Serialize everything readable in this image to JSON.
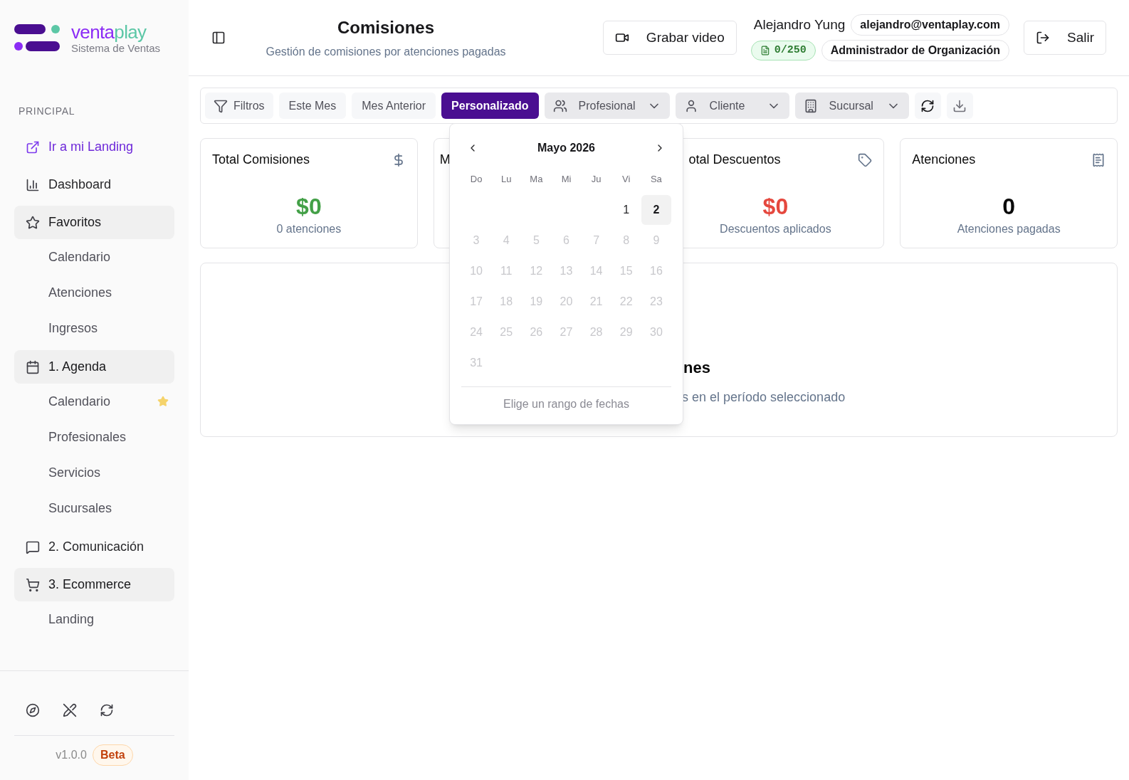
{
  "brand": {
    "parts": [
      "venta",
      "play"
    ],
    "subtitle": "Sistema de Ventas"
  },
  "header": {
    "title": "Comisiones",
    "subtitle": "Gestión de comisiones por atenciones pagadas",
    "record_button": "Grabar video",
    "user_name": "Alejandro Yung",
    "email": "alejandro@ventaplay.com",
    "quota": "0/250",
    "role": "Administrador de Organización",
    "logout_button": "Salir"
  },
  "sidebar": {
    "section": "PRINCIPAL",
    "items": [
      {
        "kind": "link",
        "label": "Ir a mi Landing"
      },
      {
        "kind": "item",
        "label": "Dashboard"
      },
      {
        "kind": "group",
        "label": "Favoritos",
        "expanded": true,
        "children": [
          {
            "label": "Calendario",
            "favorite": false
          },
          {
            "label": "Atenciones",
            "favorite": false
          },
          {
            "label": "Ingresos",
            "favorite": false
          }
        ]
      },
      {
        "kind": "group",
        "label": "1. Agenda",
        "expanded": true,
        "children": [
          {
            "label": "Calendario",
            "favorite": true
          },
          {
            "label": "Profesionales",
            "favorite": false
          },
          {
            "label": "Servicios",
            "favorite": false
          },
          {
            "label": "Sucursales",
            "favorite": false
          }
        ]
      },
      {
        "kind": "group",
        "label": "2. Comunicación",
        "expanded": false
      },
      {
        "kind": "group",
        "label": "3. Ecommerce",
        "expanded": true,
        "children": [
          {
            "label": "Landing",
            "favorite": false
          }
        ]
      }
    ],
    "version": "v1.0.0",
    "badge": "Beta"
  },
  "toolbar": {
    "filter_button": "Filtros",
    "periods": [
      {
        "label": "Este Mes",
        "selected": false
      },
      {
        "label": "Mes Anterior",
        "selected": false
      },
      {
        "label": "Personalizado",
        "selected": true
      }
    ],
    "dropdowns": [
      {
        "label": "Profesional"
      },
      {
        "label": "Cliente"
      },
      {
        "label": "Sucursal"
      }
    ]
  },
  "cards": [
    {
      "title": "Total Comisiones",
      "value": "$0",
      "caption": "0 atenciones",
      "color": "#43a047"
    },
    {
      "title": "M"
    },
    {
      "title": "otal Descuentos",
      "value": "$0",
      "caption": "Descuentos aplicados",
      "color": "#e5483e"
    },
    {
      "title": "Atenciones",
      "value": "0",
      "caption": "Atenciones pagadas",
      "color": "#0a0a0a"
    }
  ],
  "empty_state": {
    "title": "nes",
    "message": "s en el período seleccionado"
  },
  "calendar": {
    "month": "Mayo 2026",
    "weekdays": [
      "Do",
      "Lu",
      "Ma",
      "Mi",
      "Ju",
      "Vi",
      "Sa"
    ],
    "days": [
      {
        "kind": "blank"
      },
      {
        "kind": "blank"
      },
      {
        "kind": "blank"
      },
      {
        "kind": "blank"
      },
      {
        "kind": "blank"
      },
      {
        "kind": "day",
        "label": "1",
        "disabled": false,
        "selected": false
      },
      {
        "kind": "day",
        "label": "2",
        "disabled": false,
        "selected": true
      },
      {
        "kind": "day",
        "label": "3",
        "disabled": true,
        "selected": false
      },
      {
        "kind": "day",
        "label": "4",
        "disabled": true,
        "selected": false
      },
      {
        "kind": "day",
        "label": "5",
        "disabled": true,
        "selected": false
      },
      {
        "kind": "day",
        "label": "6",
        "disabled": true,
        "selected": false
      },
      {
        "kind": "day",
        "label": "7",
        "disabled": true,
        "selected": false
      },
      {
        "kind": "day",
        "label": "8",
        "disabled": true,
        "selected": false
      },
      {
        "kind": "day",
        "label": "9",
        "disabled": true,
        "selected": false
      },
      {
        "kind": "day",
        "label": "10",
        "disabled": true,
        "selected": false
      },
      {
        "kind": "day",
        "label": "11",
        "disabled": true,
        "selected": false
      },
      {
        "kind": "day",
        "label": "12",
        "disabled": true,
        "selected": false
      },
      {
        "kind": "day",
        "label": "13",
        "disabled": true,
        "selected": false
      },
      {
        "kind": "day",
        "label": "14",
        "disabled": true,
        "selected": false
      },
      {
        "kind": "day",
        "label": "15",
        "disabled": true,
        "selected": false
      },
      {
        "kind": "day",
        "label": "16",
        "disabled": true,
        "selected": false
      },
      {
        "kind": "day",
        "label": "17",
        "disabled": true,
        "selected": false
      },
      {
        "kind": "day",
        "label": "18",
        "disabled": true,
        "selected": false
      },
      {
        "kind": "day",
        "label": "19",
        "disabled": true,
        "selected": false
      },
      {
        "kind": "day",
        "label": "20",
        "disabled": true,
        "selected": false
      },
      {
        "kind": "day",
        "label": "21",
        "disabled": true,
        "selected": false
      },
      {
        "kind": "day",
        "label": "22",
        "disabled": true,
        "selected": false
      },
      {
        "kind": "day",
        "label": "23",
        "disabled": true,
        "selected": false
      },
      {
        "kind": "day",
        "label": "24",
        "disabled": true,
        "selected": false
      },
      {
        "kind": "day",
        "label": "25",
        "disabled": true,
        "selected": false
      },
      {
        "kind": "day",
        "label": "26",
        "disabled": true,
        "selected": false
      },
      {
        "kind": "day",
        "label": "27",
        "disabled": true,
        "selected": false
      },
      {
        "kind": "day",
        "label": "28",
        "disabled": true,
        "selected": false
      },
      {
        "kind": "day",
        "label": "29",
        "disabled": true,
        "selected": false
      },
      {
        "kind": "day",
        "label": "30",
        "disabled": true,
        "selected": false
      },
      {
        "kind": "day",
        "label": "31",
        "disabled": true,
        "selected": false
      }
    ],
    "footer": "Elige un rango de fechas"
  }
}
